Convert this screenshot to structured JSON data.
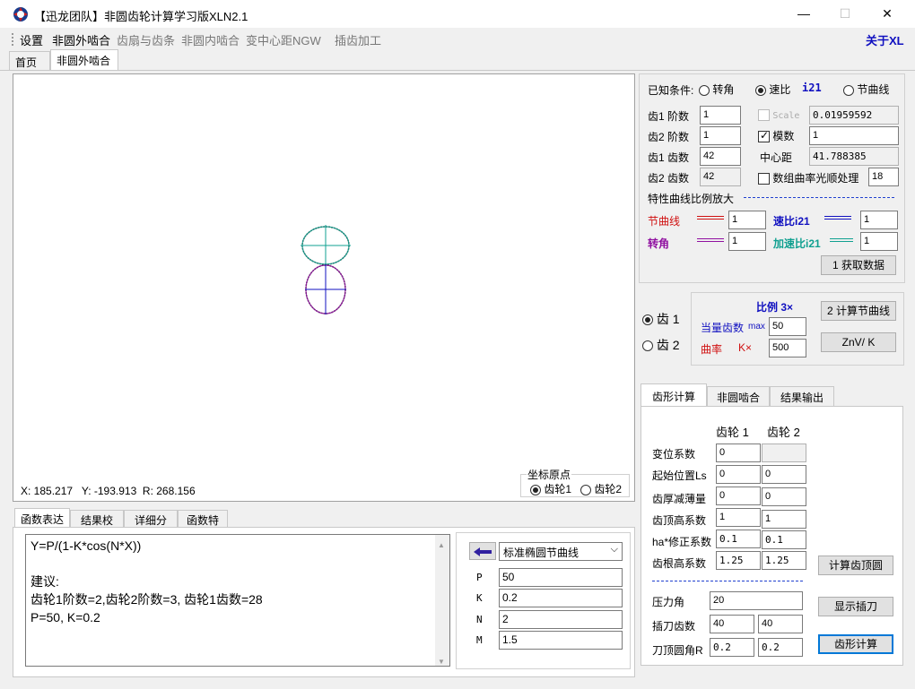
{
  "window": {
    "title": "【迅龙团队】非圆齿轮计算学习版XLN2.1",
    "minimize": "—",
    "maximize": "☐",
    "close": "✕"
  },
  "menu": {
    "items": [
      "设置",
      "非圆外啮合",
      "齿扇与齿条",
      "非圆内啮合",
      "变中心距NGW",
      "插齿加工"
    ],
    "about": "关于XL"
  },
  "tabs": [
    "首页",
    "非圆外啮合"
  ],
  "status": {
    "x": "X: 185.217",
    "y": "Y: -193.913",
    "r": "R: 268.156"
  },
  "origin": {
    "title": "坐标原点",
    "opt1": "齿轮1",
    "opt2": "齿轮2"
  },
  "known": {
    "label": "已知条件:",
    "opt_angle": "转角",
    "opt_speed": "速比",
    "speed_tag": "i21",
    "opt_pitch": "节曲线",
    "g1_order_label": "齿1 阶数",
    "g1_order": "1",
    "g2_order_label": "齿2 阶数",
    "g2_order": "1",
    "g1_teeth_label": "齿1 齿数",
    "g1_teeth": "42",
    "g2_teeth_label": "齿2 齿数",
    "g2_teeth": "42",
    "scale_label": "Scale",
    "scale": "0.01959592",
    "module_label": "模数",
    "module": "1",
    "center_label": "中心距",
    "center": "41.788385",
    "smooth_label": "数组曲率光顺处理",
    "smooth": "18"
  },
  "curve": {
    "title": "特性曲线比例放大",
    "pitch_label": "节曲线",
    "pitch_val": "1",
    "speed_label": "速比i21",
    "speed_val": "1",
    "angle_label": "转角",
    "angle_val": "1",
    "accel_label": "加速比i21",
    "accel_val": "1",
    "fetch_btn": "1 获取数据"
  },
  "ratio": {
    "gear1": "齿 1",
    "gear2": "齿 2",
    "title": "比例 3×",
    "eq_teeth_label": "当量齿数",
    "max_label": "max",
    "eq_teeth": "50",
    "curv_label": "曲率",
    "k_label": "K×",
    "curv": "500",
    "calc_btn": "2 计算节曲线",
    "znv_btn": "ZnV/ K"
  },
  "tooth": {
    "tabs": [
      "齿形计算",
      "非圆啮合",
      "结果输出"
    ],
    "col1": "齿轮 1",
    "col2": "齿轮 2",
    "rows": [
      {
        "label": "变位系数",
        "v1": "0",
        "v2": ""
      },
      {
        "label": "起始位置Ls",
        "v1": "0",
        "v2": "0"
      },
      {
        "label": "齿厚减薄量",
        "v1": "0",
        "v2": "0"
      },
      {
        "label": "齿顶高系数",
        "v1": "1",
        "v2": "1"
      },
      {
        "label": "ha*修正系数",
        "v1": "0.1",
        "v2": "0.1"
      },
      {
        "label": "齿根高系数",
        "v1": "1.25",
        "v2": "1.25"
      }
    ],
    "pressure_label": "压力角",
    "pressure": "20",
    "cutter_teeth_label": "插刀齿数",
    "cutter_teeth1": "40",
    "cutter_teeth2": "40",
    "tip_radius_label": "刀顶圆角R",
    "tip_radius1": "0.2",
    "tip_radius2": "0.2",
    "btn_addendum": "计算齿顶圆",
    "btn_show_cutter": "显示插刀",
    "btn_calc": "齿形计算"
  },
  "func": {
    "tabs": [
      "函数表达",
      "结果校验",
      "详细分析",
      "函数特例"
    ],
    "text_lines": [
      "Y=P/(1-K*cos(N*X))",
      "",
      "建议:",
      "齿轮1阶数=2,齿轮2阶数=3, 齿轮1齿数=28",
      "P=50, K=0.2"
    ],
    "preset": "标准椭圆节曲线",
    "params": [
      {
        "label": "P",
        "value": "50"
      },
      {
        "label": "K",
        "value": "0.2"
      },
      {
        "label": "N",
        "value": "2"
      },
      {
        "label": "M",
        "value": "1.5"
      }
    ]
  },
  "colors": {
    "pitch": "#d01010",
    "speed": "#1010c0",
    "angle": "#9010a0",
    "accel": "#10a090",
    "accent": "#0050a0"
  }
}
